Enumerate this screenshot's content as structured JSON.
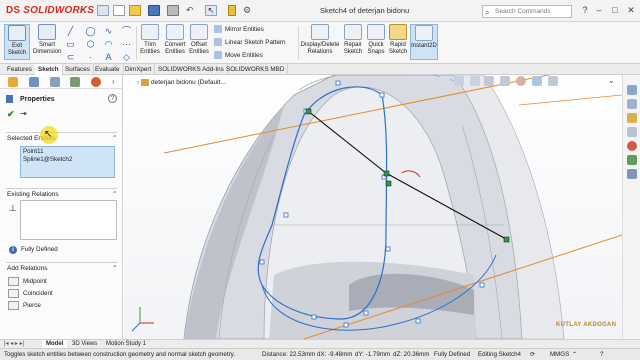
{
  "app": {
    "logo_prefix": "DS",
    "logo_text": "SOLIDWORKS",
    "document_title": "Sketch4 of deterjan bidonu",
    "search_placeholder": "Search Commands"
  },
  "commands": {
    "exit_sketch": "Exit\nSketch",
    "smart_dimension": "Smart\nDimension",
    "trim_entities": "Trim\nEntities",
    "convert_entities": "Convert\nEntities",
    "offset_entities": "Offset\nEntities",
    "mirror_entities": "Mirror Entities",
    "linear_sketch_pattern": "Linear Sketch Pattern",
    "move_entities": "Move Entities",
    "display_delete_relations": "Display/Delete\nRelations",
    "repair_sketch": "Repair\nSketch",
    "quick_snaps": "Quick\nSnaps",
    "rapid_sketch": "Rapid\nSketch",
    "instant2d": "Instant2D"
  },
  "tabs": [
    "Features",
    "Sketch",
    "Surfaces",
    "Evaluate",
    "DimXpert",
    "SOLIDWORKS Add-Ins",
    "SOLIDWORKS MBD"
  ],
  "active_tab": "Sketch",
  "property_manager": {
    "title": "Properties",
    "selected_entities_label": "Selected Entities",
    "selected_entities": [
      "Point11",
      "Spline1@Sketch2"
    ],
    "existing_relations_label": "Existing Relations",
    "status": "Fully Defined",
    "add_relations_label": "Add Relations",
    "relations": [
      "Midpoint",
      "Coincident",
      "Pierce"
    ]
  },
  "tree": {
    "item": "deterjan bidonu  (Default..."
  },
  "bottom_tabs": [
    "Model",
    "3D Views",
    "Motion Study 1"
  ],
  "statusbar": {
    "message": "Toggles sketch entities between construction geometry and normal sketch geometry.",
    "distance": "Distance: 22.53mm",
    "dx": "dX: -9.48mm",
    "dy": "dY: -1.79mm",
    "dz": "dZ: 20.36mm",
    "definition": "Fully Defined",
    "editing": "Editing Sketch4",
    "units": "MMGS"
  },
  "watermark": "KUTLAY AKDOGAN",
  "colors": {
    "brand": "#d52b1e",
    "sketch_blue": "#2f6fc9",
    "construction_orange": "#e58a2c",
    "selection_fill": "#cfe4f7"
  }
}
